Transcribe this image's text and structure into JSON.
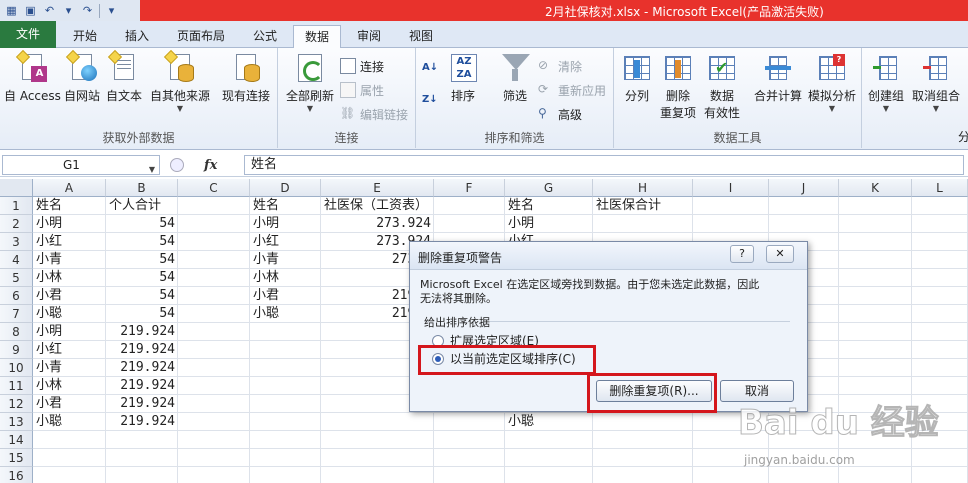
{
  "window": {
    "title": "2月社保核对.xlsx  -  Microsoft Excel(产品激活失败)"
  },
  "tabs": [
    {
      "label": "文件"
    },
    {
      "label": "开始"
    },
    {
      "label": "插入"
    },
    {
      "label": "页面布局"
    },
    {
      "label": "公式"
    },
    {
      "label": "数据"
    },
    {
      "label": "审阅"
    },
    {
      "label": "视图"
    }
  ],
  "ribbon": {
    "get_external": {
      "label": "获取外部数据",
      "access": "自 Access",
      "web": "自网站",
      "text": "自文本",
      "other": "自其他来源",
      "existing": "现有连接"
    },
    "connections": {
      "label": "连接",
      "refresh_all": "全部刷新",
      "connect": "连接",
      "properties": "属性",
      "edit_links": "编辑链接"
    },
    "sort_filter": {
      "label": "排序和筛选",
      "sort": "排序",
      "filter": "筛选",
      "clear": "清除",
      "reapply": "重新应用",
      "advanced": "高级"
    },
    "data_tools": {
      "label": "数据工具",
      "split": "分列",
      "remove_dup_1": "删除",
      "remove_dup_2": "重复项",
      "validation_1": "数据",
      "validation_2": "有效性",
      "consolidate": "合并计算",
      "whatif": "模拟分析"
    },
    "outline": {
      "group": "创建组",
      "ungroup": "取消组合",
      "subtotal": "分"
    }
  },
  "formula_bar": {
    "name_box": "G1",
    "fx": "fx",
    "value": "姓名"
  },
  "sheet": {
    "columns": [
      "A",
      "B",
      "C",
      "D",
      "E",
      "F",
      "G",
      "H",
      "I",
      "J",
      "K",
      "L"
    ],
    "rows": [
      "1",
      "2",
      "3",
      "4",
      "5",
      "6",
      "7",
      "8",
      "9",
      "10",
      "11",
      "12",
      "13",
      "14",
      "15",
      "16"
    ],
    "col_a": [
      "姓名",
      "小明",
      "小红",
      "小青",
      "小林",
      "小君",
      "小聪",
      "小明",
      "小红",
      "小青",
      "小林",
      "小君",
      "小聪"
    ],
    "col_b": [
      "个人合计",
      "54",
      "54",
      "54",
      "54",
      "54",
      "54",
      "219.924",
      "219.924",
      "219.924",
      "219.924",
      "219.924",
      "219.924"
    ],
    "col_d": [
      "姓名",
      "小明",
      "小红",
      "小青",
      "小林",
      "小君",
      "小聪"
    ],
    "col_e": [
      "社医保（工资表）",
      "273.924",
      "273.924",
      "273.9",
      "219.9",
      "219.9"
    ],
    "col_g": [
      "姓名",
      "小明",
      "小红"
    ],
    "g13": "小聪",
    "h1": "社医保合计"
  },
  "dialog": {
    "title": "删除重复项警告",
    "help": "?",
    "close": "✕",
    "message_line1": "Microsoft Excel 在选定区域旁找到数据。由于您未选定此数据，因此",
    "message_line2": "无法将其删除。",
    "group_label": "给出排序依据",
    "option_expand": "扩展选定区域(E)",
    "option_current": "以当前选定区域排序(C)",
    "btn_remove": "删除重复项(R)...",
    "btn_cancel": "取消"
  },
  "watermark": {
    "logo": "Bai du 经验",
    "url": "jingyan.baidu.com"
  }
}
